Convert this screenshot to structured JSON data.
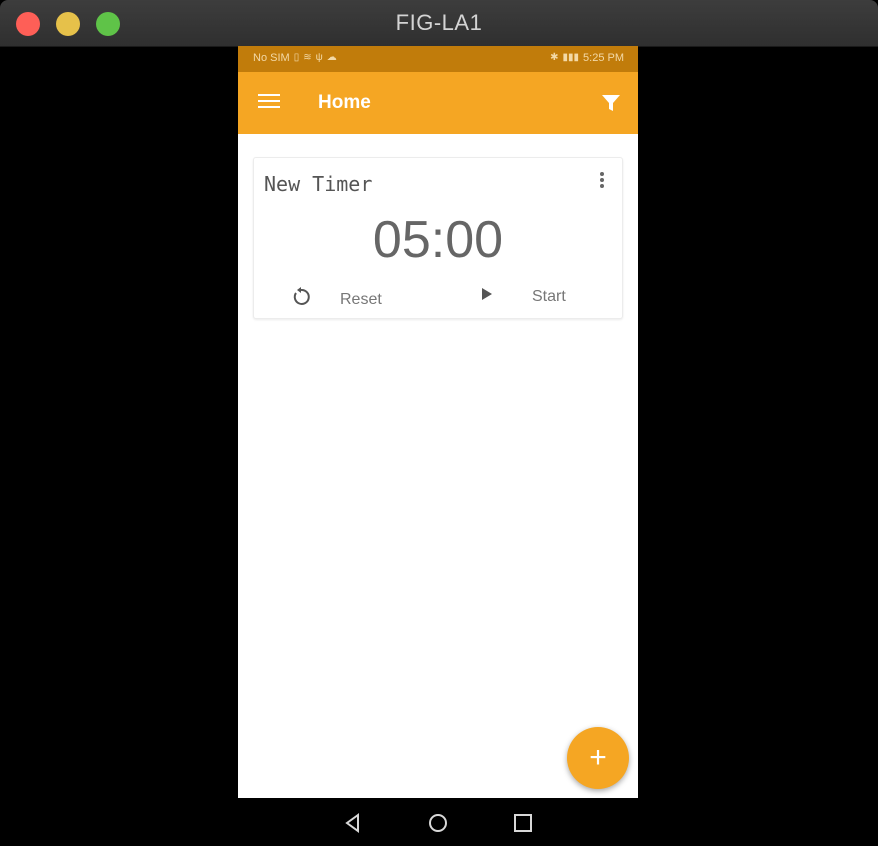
{
  "window": {
    "title": "FIG-LA1"
  },
  "statusbar": {
    "left_text": "No SIM",
    "right_time": "5:25 PM"
  },
  "appbar": {
    "title": "Home",
    "menu_icon": "menu-icon",
    "filter_icon": "filter-icon"
  },
  "timer_card": {
    "name": "New Timer",
    "time": "05:00",
    "reset_label": "Reset",
    "start_label": "Start"
  },
  "fab": {
    "label": "+"
  },
  "colors": {
    "accent": "#f5a623",
    "statusbar": "#c17c0b"
  }
}
